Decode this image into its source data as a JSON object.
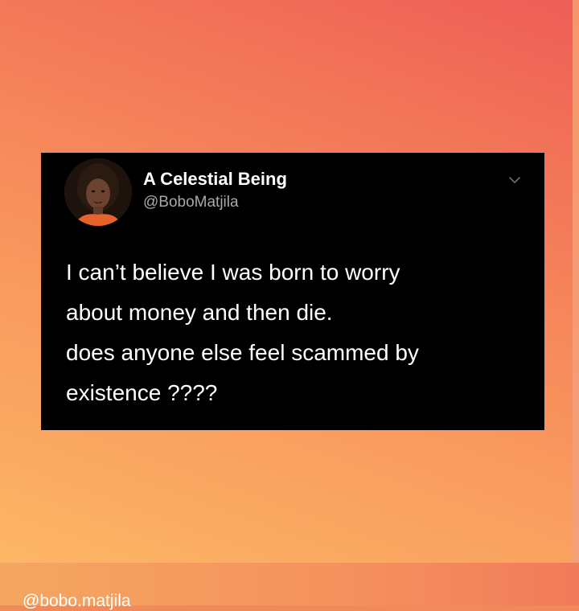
{
  "tweet": {
    "display_name": "A Celestial Being",
    "handle": "@BoboMatjila",
    "lines": [
      "I can’t believe I was born to worry",
      "about money and then die.",
      "does anyone else feel scammed by",
      "existence ????"
    ],
    "avatar_icon": "profile-photo",
    "menu_icon": "chevron-down-icon"
  },
  "watermark": "@bobo.matjila",
  "colors": {
    "background_start": "#fcb765",
    "background_end": "#ef5e58",
    "card": "#000000",
    "name": "#ffffff",
    "handle": "#a9a9a9"
  }
}
